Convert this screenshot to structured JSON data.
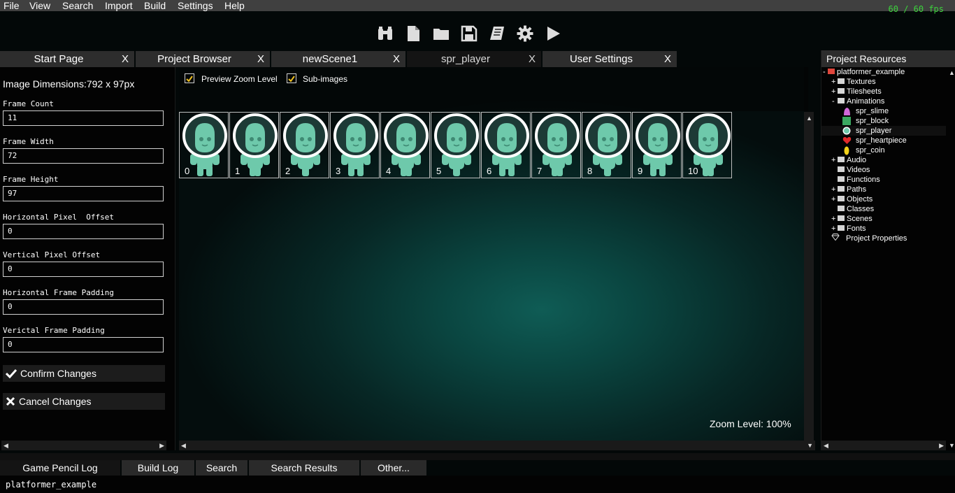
{
  "menu": [
    "File",
    "View",
    "Search",
    "Import",
    "Build",
    "Settings",
    "Help"
  ],
  "fps": "60 / 60 fps",
  "toolbar": {
    "icons": [
      "binoculars-icon",
      "new-file-icon",
      "open-folder-icon",
      "save-icon",
      "book-icon",
      "gear-icon",
      "play-icon"
    ]
  },
  "tabs": [
    {
      "label": "Start Page",
      "close": "X"
    },
    {
      "label": "Project Browser",
      "close": "X"
    },
    {
      "label": "newScene1",
      "close": "X"
    },
    {
      "label": "spr_player",
      "close": "X"
    },
    {
      "label": "User Settings",
      "close": "X"
    }
  ],
  "left": {
    "dimensions": "Image Dimensions:792 x 97px",
    "fields": [
      {
        "label": "Frame Count",
        "value": "11"
      },
      {
        "label": "Frame Width",
        "value": "72"
      },
      {
        "label": "Frame Height",
        "value": "97"
      },
      {
        "label": "Horizontal Pixel  Offset",
        "value": "0"
      },
      {
        "label": "Vertical Pixel Offset",
        "value": "0"
      },
      {
        "label": "Horizontal Frame Padding",
        "value": "0"
      },
      {
        "label": "Verictal Frame Padding",
        "value": "0"
      }
    ],
    "confirm": "Confirm Changes",
    "cancel": "Cancel Changes"
  },
  "canvas": {
    "preview_zoom": "Preview Zoom Level",
    "subimages": "Sub-images",
    "frames": [
      "0",
      "1",
      "2",
      "3",
      "4",
      "5",
      "6",
      "7",
      "8",
      "9",
      "10"
    ],
    "zoom": "Zoom Level: 100%"
  },
  "resources": {
    "title": "Project Resources",
    "root": "platformer_example",
    "items": [
      {
        "label": "Textures",
        "exp": "+"
      },
      {
        "label": "Tilesheets",
        "exp": "+"
      },
      {
        "label": "Animations",
        "exp": "-"
      },
      {
        "label": "spr_slime",
        "exp": ""
      },
      {
        "label": "spr_block",
        "exp": ""
      },
      {
        "label": "spr_player",
        "exp": ""
      },
      {
        "label": "spr_heartpiece",
        "exp": ""
      },
      {
        "label": "spr_coin",
        "exp": ""
      },
      {
        "label": "Audio",
        "exp": "+"
      },
      {
        "label": "Videos",
        "exp": ""
      },
      {
        "label": "Functions",
        "exp": ""
      },
      {
        "label": "Paths",
        "exp": "+"
      },
      {
        "label": "Objects",
        "exp": "+"
      },
      {
        "label": "Classes",
        "exp": ""
      },
      {
        "label": "Scenes",
        "exp": "+"
      },
      {
        "label": "Fonts",
        "exp": "+"
      },
      {
        "label": "Project Properties",
        "exp": ""
      }
    ]
  },
  "bottom_tabs": [
    "Game Pencil Log",
    "Build Log",
    "Search",
    "Search Results",
    "Other..."
  ],
  "log": "platformer_example",
  "colors": {
    "fps": "#3cd23c",
    "root_folder": "#e0463c",
    "slime": "#d068d8",
    "block": "#3aa860",
    "heart": "#e02a2a",
    "coin": "#f2d21a",
    "player": "#6ec9ab"
  }
}
